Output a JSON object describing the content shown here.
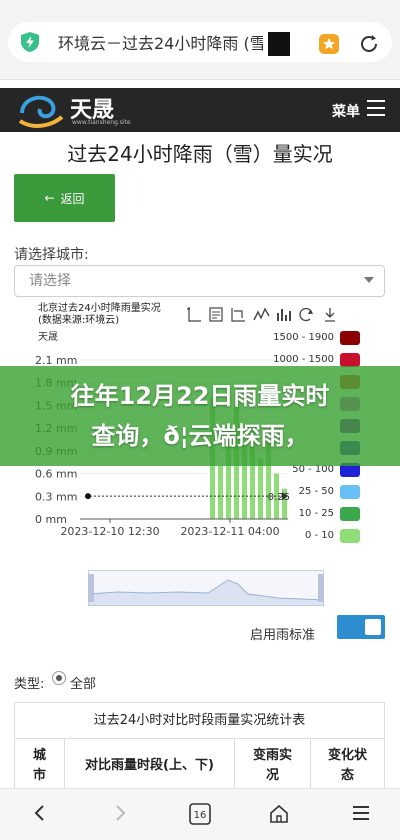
{
  "browser": {
    "tab_title": "环境云－过去24小时降雨 (雪",
    "nav": {
      "back_icon": "chevron-left-icon",
      "forward_icon": "chevron-right-icon",
      "tabs_count": "16",
      "home_icon": "home-icon",
      "menu_icon": "hamburger-icon"
    }
  },
  "site": {
    "logo_text": "天晟",
    "logo_url": "www.tiansheng.site",
    "menu_label": "菜单"
  },
  "page": {
    "title": "过去24小时降雨（雪）量实况",
    "back_label": "返回",
    "city_label": "请选择城市:",
    "city_placeholder": "请选择"
  },
  "chart": {
    "title_line1": "北京过去24小时降雨量实况",
    "title_line2": "(数据来源:环境云)",
    "toolbar_icons": [
      "line-tool-icon",
      "dataview-icon",
      "zoom-icon",
      "line-chart-icon",
      "bar-chart-icon",
      "restore-icon",
      "download-icon"
    ],
    "legend_title": "天晟",
    "standard_label": "启用雨标准",
    "standard_enabled": true
  },
  "chart_data": {
    "type": "bar",
    "y_ticks": [
      "2.1 mm",
      "1.8 mm",
      "1.5 mm",
      "1.2 mm",
      "0.9 mm",
      "0.6 mm",
      "0.3 mm",
      "0 mm"
    ],
    "ylim": [
      0,
      2.1
    ],
    "x_ticks": [
      "2023-12-10 12:30",
      "2023-12-11 04:00"
    ],
    "markline_label": "0.25",
    "markline_value": 0.25,
    "bars": [
      1.6,
      0.7,
      1.2,
      1.5,
      1.0,
      1.2,
      0.8,
      1.0,
      0.6,
      0.4,
      0.5,
      0.3
    ],
    "legend": [
      {
        "label": "1500 - 1900",
        "color": "#8b0000"
      },
      {
        "label": "1000 - 1500",
        "color": "#c8102e"
      },
      {
        "label": "",
        "color": "#e8483c"
      },
      {
        "label": "",
        "color": "#d35cd0"
      },
      {
        "label": "",
        "color": "#7a1fb8"
      },
      {
        "label": "",
        "color": "#3f34c9"
      },
      {
        "label": "50 - 100",
        "color": "#1e22d6"
      },
      {
        "label": "25 - 50",
        "color": "#66bff5"
      },
      {
        "label": "10 - 25",
        "color": "#3ba84c"
      },
      {
        "label": "0 - 10",
        "color": "#8fdd79"
      }
    ]
  },
  "overlay": {
    "line1": "往年12月22日雨量实时",
    "line2": "查询，ð¦云端探雨，"
  },
  "filter": {
    "type_label": "类型:",
    "type_option": "全部"
  },
  "table": {
    "caption": "过去24小时对比时段雨量实况统计表",
    "headers": [
      "城市",
      "对比雨量时段(上、下)",
      "变雨实况",
      "变化状态"
    ]
  }
}
